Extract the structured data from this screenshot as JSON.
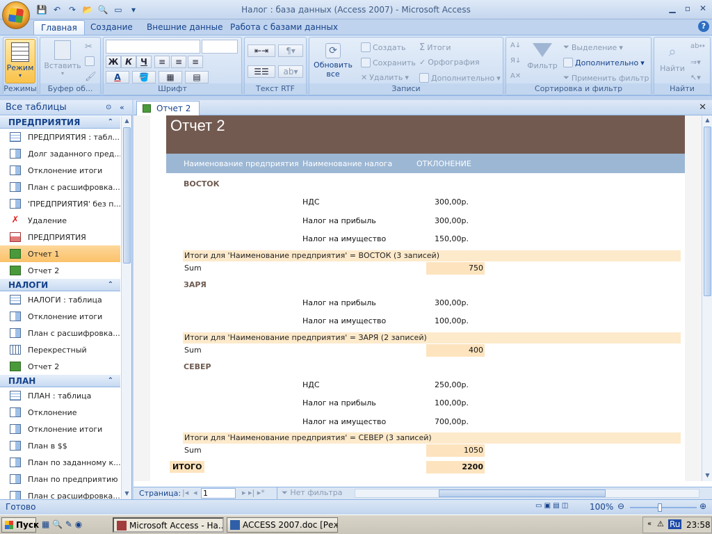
{
  "window": {
    "title": "Налог : база данных (Access 2007) - Microsoft Access"
  },
  "ribbon_tabs": [
    "Главная",
    "Создание",
    "Внешние данные",
    "Работа с базами данных"
  ],
  "ribbon": {
    "modes": {
      "button": "Режим",
      "group": "Режимы"
    },
    "clipboard": {
      "paste": "Вставить",
      "group": "Буфер об..."
    },
    "font": {
      "group": "Шрифт",
      "bold": "Ж",
      "italic": "К",
      "underline": "Ч",
      "font_color": "A"
    },
    "rtf": {
      "group": "Текст RTF"
    },
    "records": {
      "refresh": "Обновить",
      "refresh_sub": "все",
      "create": "Создать",
      "save": "Сохранить",
      "delete": "Удалить",
      "totals": "Итоги",
      "spelling": "Орфография",
      "more": "Дополнительно",
      "group": "Записи"
    },
    "sort": {
      "filter": "Фильтр",
      "selection": "Выделение",
      "advanced": "Дополнительно",
      "apply_filter": "Применить фильтр",
      "group": "Сортировка и фильтр"
    },
    "find": {
      "find": "Найти",
      "group": "Найти"
    }
  },
  "nav": {
    "header": "Все таблицы",
    "groups": [
      {
        "name": "ПРЕДПРИЯТИЯ",
        "items": [
          {
            "label": "ПРЕДПРИЯТИЯ : табл...",
            "type": "tbl"
          },
          {
            "label": "Долг заданного пред...",
            "type": "qry"
          },
          {
            "label": "Отклонение итоги",
            "type": "qry"
          },
          {
            "label": "План с расшифровка...",
            "type": "qry"
          },
          {
            "label": "'ПРЕДПРИЯТИЯ' без п...",
            "type": "qry"
          },
          {
            "label": "Удаление",
            "type": "del"
          },
          {
            "label": "ПРЕДПРИЯТИЯ",
            "type": "frm"
          },
          {
            "label": "Отчет 1",
            "type": "rpt",
            "selected": true
          },
          {
            "label": "Отчет 2",
            "type": "rpt"
          }
        ]
      },
      {
        "name": "НАЛОГИ",
        "items": [
          {
            "label": "НАЛОГИ : таблица",
            "type": "tbl"
          },
          {
            "label": "Отклонение итоги",
            "type": "qry"
          },
          {
            "label": "План с расшифровка...",
            "type": "qry"
          },
          {
            "label": "Перекрестный",
            "type": "xtab"
          },
          {
            "label": "Отчет 2",
            "type": "rpt"
          }
        ]
      },
      {
        "name": "ПЛАН",
        "items": [
          {
            "label": "ПЛАН : таблица",
            "type": "tbl"
          },
          {
            "label": "Отклонение",
            "type": "qry"
          },
          {
            "label": "Отклонение итоги",
            "type": "qry"
          },
          {
            "label": "План в $$",
            "type": "qry"
          },
          {
            "label": "План по заданному к...",
            "type": "qry"
          },
          {
            "label": "План по предприятию",
            "type": "qry"
          },
          {
            "label": "План с расшифровка...",
            "type": "qry"
          }
        ]
      }
    ]
  },
  "doc": {
    "tab": "Отчет 2"
  },
  "report": {
    "title": "Отчет 2",
    "col_company": "Наименование предприятия",
    "col_tax": "Наименование налога",
    "col_dev": "ОТКЛОНЕНИЕ",
    "groups": [
      {
        "name": "ВОСТОК",
        "rows": [
          [
            "НДС",
            "300,00р."
          ],
          [
            "Налог на прибыль",
            "300,00р."
          ],
          [
            "Налог на имущество",
            "150,00р."
          ]
        ],
        "summary": "Итоги для 'Наименование предприятия' = ВОСТОК (3 записей)",
        "sum_label": "Sum",
        "sum": "750"
      },
      {
        "name": "ЗАРЯ",
        "rows": [
          [
            "Налог на прибыль",
            "300,00р."
          ],
          [
            "Налог на имущество",
            "100,00р."
          ]
        ],
        "summary": "Итоги для 'Наименование предприятия' = ЗАРЯ (2 записей)",
        "sum_label": "Sum",
        "sum": "400"
      },
      {
        "name": "СЕВЕР",
        "rows": [
          [
            "НДС",
            "250,00р."
          ],
          [
            "Налог на прибыль",
            "100,00р."
          ],
          [
            "Налог на имущество",
            "700,00р."
          ]
        ],
        "summary": "Итоги для 'Наименование предприятия' = СЕВЕР (3 записей)",
        "sum_label": "Sum",
        "sum": "1050"
      }
    ],
    "grand_label": "ИТОГО",
    "grand_total": "2200"
  },
  "record_nav": {
    "label": "Страница:",
    "page": "1",
    "filter": "Нет фильтра"
  },
  "status": {
    "text": "Готово",
    "zoom": "100%"
  },
  "taskbar": {
    "start": "Пуск",
    "task1": "Microsoft Access - На...",
    "task2": "ACCESS 2007.doc [Режи...",
    "lang": "Ru",
    "time": "23:58"
  }
}
